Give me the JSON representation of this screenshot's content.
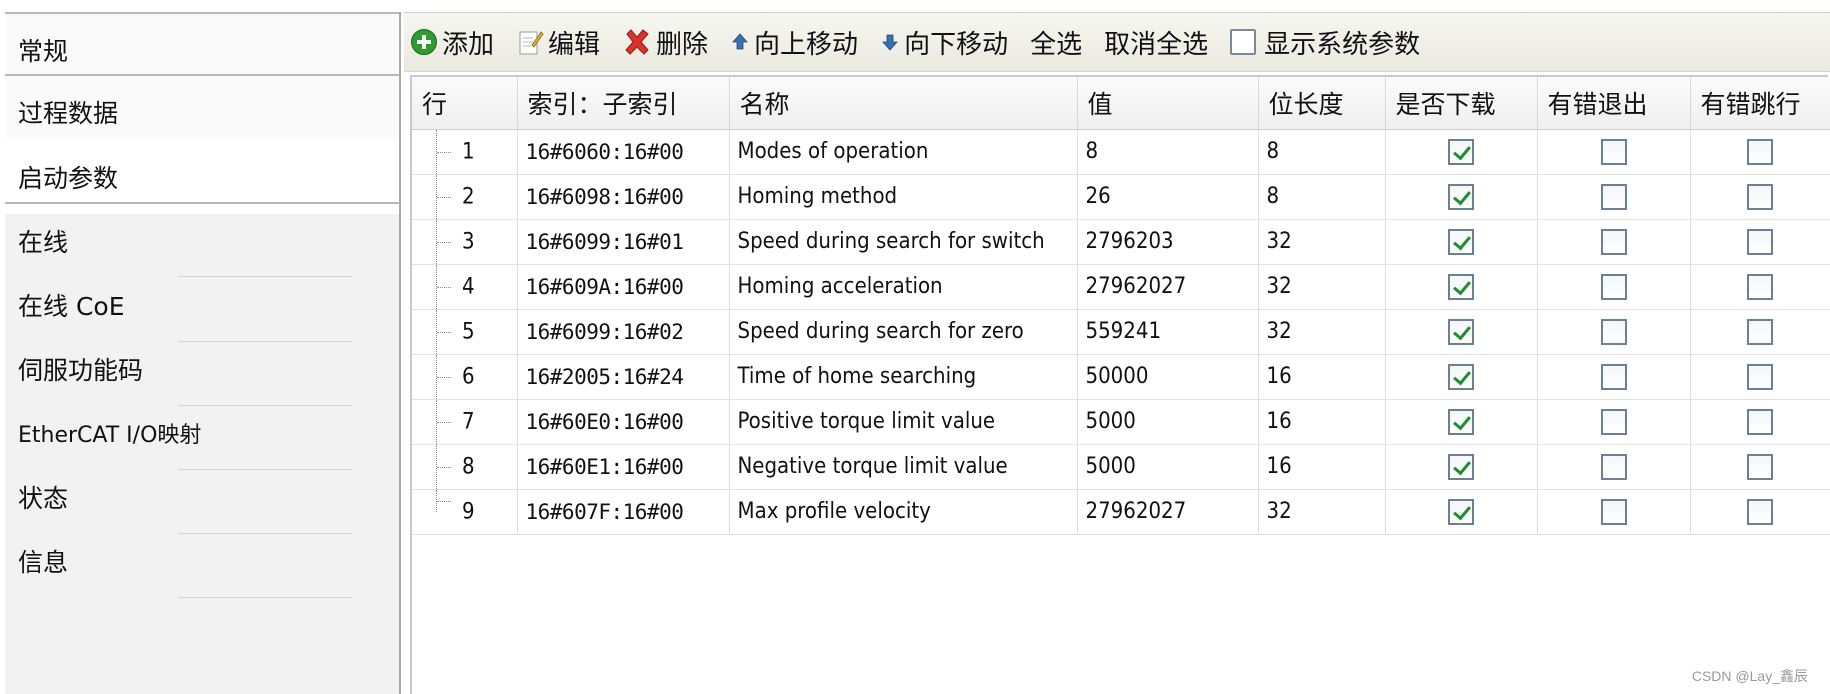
{
  "sidebar": {
    "items": [
      {
        "label": "常规"
      },
      {
        "label": "过程数据"
      },
      {
        "label": "启动参数"
      },
      {
        "label": "在线"
      },
      {
        "label": "在线 CoE"
      },
      {
        "label": "伺服功能码"
      },
      {
        "label": "EtherCAT I/O映射"
      },
      {
        "label": "状态"
      },
      {
        "label": "信息"
      }
    ],
    "active_index": 2
  },
  "toolbar": {
    "add_label": "添加",
    "edit_label": "编辑",
    "delete_label": "删除",
    "move_up_label": "向上移动",
    "move_down_label": "向下移动",
    "select_all_label": "全选",
    "deselect_all_label": "取消全选",
    "show_system_params_label": "显示系统参数",
    "show_system_params_checked": false
  },
  "table": {
    "columns": [
      "行",
      "索引：子索引",
      "名称",
      "值",
      "位长度",
      "是否下载",
      "有错退出",
      "有错跳行"
    ],
    "rows": [
      {
        "row": "1",
        "index": "16#6060:16#00",
        "name": "Modes of operation",
        "value": "8",
        "bitlen": "8",
        "download": true,
        "exit_on_error": false,
        "skip_on_error": false
      },
      {
        "row": "2",
        "index": "16#6098:16#00",
        "name": "Homing method",
        "value": "26",
        "bitlen": "8",
        "download": true,
        "exit_on_error": false,
        "skip_on_error": false
      },
      {
        "row": "3",
        "index": "16#6099:16#01",
        "name": "Speed during search for switch",
        "value": "2796203",
        "bitlen": "32",
        "download": true,
        "exit_on_error": false,
        "skip_on_error": false
      },
      {
        "row": "4",
        "index": "16#609A:16#00",
        "name": "Homing acceleration",
        "value": "27962027",
        "bitlen": "32",
        "download": true,
        "exit_on_error": false,
        "skip_on_error": false
      },
      {
        "row": "5",
        "index": "16#6099:16#02",
        "name": "Speed during search for zero",
        "value": "559241",
        "bitlen": "32",
        "download": true,
        "exit_on_error": false,
        "skip_on_error": false
      },
      {
        "row": "6",
        "index": "16#2005:16#24",
        "name": "Time of home searching",
        "value": "50000",
        "bitlen": "16",
        "download": true,
        "exit_on_error": false,
        "skip_on_error": false
      },
      {
        "row": "7",
        "index": "16#60E0:16#00",
        "name": "Positive torque limit value",
        "value": "5000",
        "bitlen": "16",
        "download": true,
        "exit_on_error": false,
        "skip_on_error": false
      },
      {
        "row": "8",
        "index": "16#60E1:16#00",
        "name": "Negative torque limit value",
        "value": "5000",
        "bitlen": "16",
        "download": true,
        "exit_on_error": false,
        "skip_on_error": false
      },
      {
        "row": "9",
        "index": "16#607F:16#00",
        "name": "Max profile velocity",
        "value": "27962027",
        "bitlen": "32",
        "download": true,
        "exit_on_error": false,
        "skip_on_error": false
      }
    ]
  },
  "watermark": "CSDN @Lay_鑫辰",
  "colors": {
    "add_icon": "#2e9b2e",
    "delete_icon": "#d9342b",
    "arrow_icon": "#3a6fb0",
    "checkmark": "#1d8f2e"
  }
}
